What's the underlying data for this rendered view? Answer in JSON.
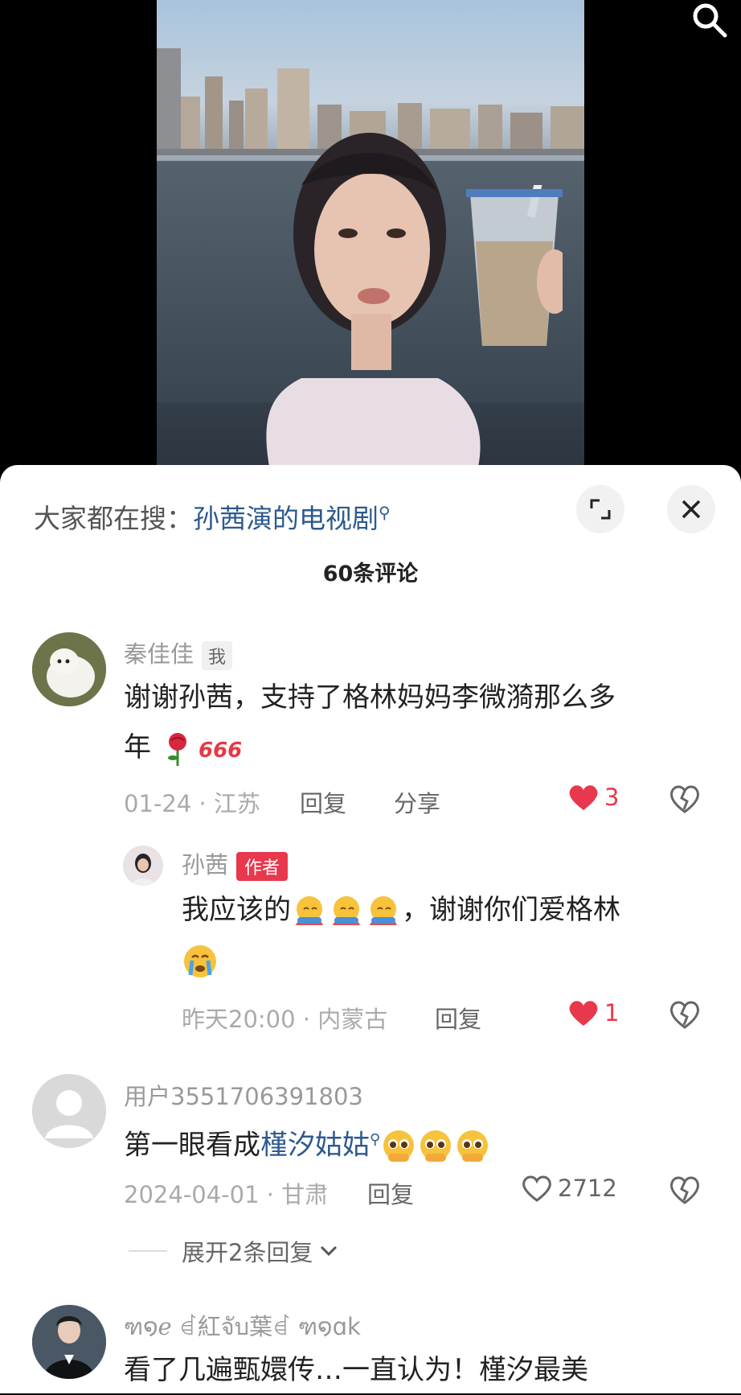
{
  "video": {
    "search_icon": "search-icon"
  },
  "sheet": {
    "hot_search_prefix": "大家都在搜：",
    "hot_search_keyword": "孙茜演的电视剧",
    "comment_count": "60条评论"
  },
  "comments": [
    {
      "user": "秦佳佳",
      "tag": "我",
      "text_line1": "谢谢孙茜，支持了格林妈妈李微漪那么多",
      "text_line2": "年",
      "emoji": [
        "rose-emoji",
        "666-emoji"
      ],
      "meta": "01-24 · 江苏",
      "reply_label": "回复",
      "share_label": "分享",
      "likes": "3",
      "liked": true,
      "reply": {
        "user": "孙茜",
        "tag": "作者",
        "text_part1": "我应该的",
        "text_part2": "，谢谢你们爱格林",
        "emoji": [
          "hug-emoji",
          "hug-emoji",
          "hug-emoji",
          "crying-emoji"
        ],
        "meta": "昨天20:00 · 内蒙古",
        "reply_label": "回复",
        "likes": "1",
        "liked": true
      }
    },
    {
      "user": "用户3551706391803",
      "text_part1": "第一眼看成",
      "text_link": "槿汐姑姑",
      "emoji": [
        "pleading-emoji",
        "pleading-emoji",
        "pleading-emoji"
      ],
      "meta": "2024-04-01 · 甘肃",
      "reply_label": "回复",
      "likes": "2712",
      "liked": false,
      "expand_label": "展开2条回复"
    },
    {
      "user": "ฑ໑ℯ ꀸ紅จับ葉ꀸ ฑ໑ɑk",
      "text": "看了几遍甄嬛传…一直认为！槿汐最美"
    }
  ],
  "colors": {
    "accent_blue": "#2d5a8e",
    "like_red": "#e8384e",
    "meta_gray": "#aaaaaa"
  }
}
